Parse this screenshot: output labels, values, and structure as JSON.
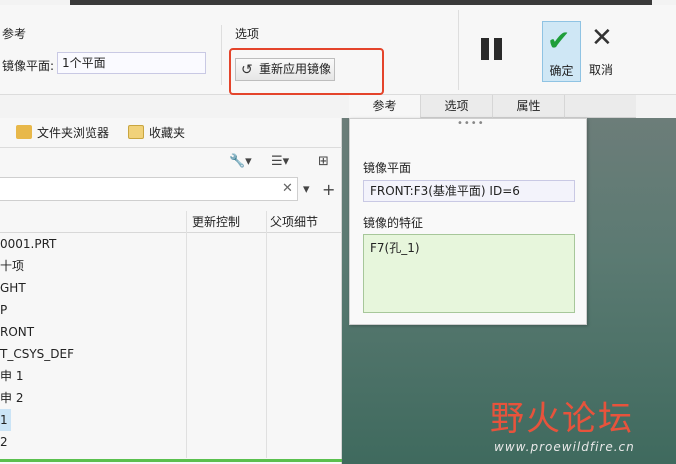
{
  "ribbon": {
    "group_reference_title": "参考",
    "mirror_plane_label": "镜像平面:",
    "mirror_plane_value": "1个平面",
    "group_options_title": "选项",
    "reapply_mirror_label": "重新应用镜像",
    "ok_label": "确定",
    "cancel_label": "取消"
  },
  "panel_tabs": [
    "参考",
    "选项",
    "属性"
  ],
  "navigator": {
    "tabs": [
      "文件夹浏览器",
      "收藏夹"
    ],
    "columns": [
      "更新控制",
      "父项细节"
    ],
    "tree_items": [
      "0001.PRT",
      "十项",
      "GHT",
      "P",
      "RONT",
      "T_CSYS_DEF",
      "申 1",
      "申 2",
      "1",
      "2"
    ],
    "selected_index": 8
  },
  "reference_panel": {
    "mirror_plane_label": "镜像平面",
    "mirror_plane_value": "FRONT:F3(基准平面) ID=6",
    "mirrored_features_label": "镜像的特征",
    "mirrored_features": [
      "F7(孔_1)"
    ]
  },
  "watermark": {
    "main": "野火论坛",
    "sub": "www.proewildfire.cn"
  },
  "colors": {
    "highlight": "#e4442b",
    "ok_check": "#1f9e3a",
    "feature_box_bg": "#e7f6dc"
  }
}
